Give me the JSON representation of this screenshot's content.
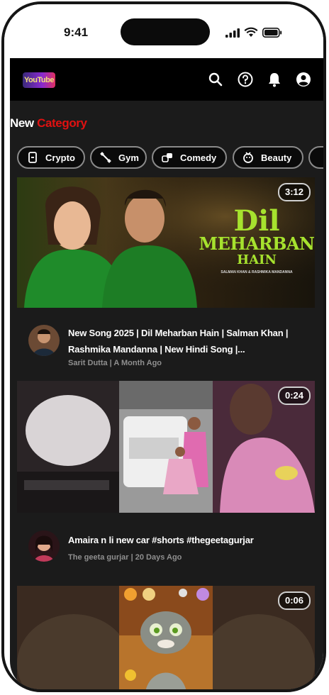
{
  "status_bar": {
    "time": "9:41"
  },
  "app_bar": {
    "logo_text": "YouTube",
    "icons": [
      "search-icon",
      "help-icon",
      "bell-icon",
      "account-icon"
    ]
  },
  "category_header": {
    "prefix": "New",
    "highlight": "Category",
    "highlight_color": "#e01111"
  },
  "chips": [
    {
      "label": "Crypto",
      "icon": "crypto-icon"
    },
    {
      "label": "Gym",
      "icon": "gym-icon"
    },
    {
      "label": "Comedy",
      "icon": "comedy-icon"
    },
    {
      "label": "Beauty",
      "icon": "beauty-icon"
    }
  ],
  "videos": [
    {
      "duration": "3:12",
      "thumbnail_text": {
        "line1": "Dil",
        "line2": "MEHARBAN",
        "line3": "HAIN",
        "line4": "SALMAN KHAN & RASHMIKA MANDANNA"
      },
      "title": "New Song 2025 | Dil Meharban Hain | Salman Khan | Rashmika Mandanna | New Hindi Song |...",
      "channel_info": "Sarit Dutta | A Month Ago"
    },
    {
      "duration": "0:24",
      "title": "Amaira n li new car #shorts #thegeetagurjar",
      "channel_info": "The geeta gurjar | 20 Days Ago"
    },
    {
      "duration": "0:06"
    }
  ],
  "colors": {
    "background": "#1b1b1b",
    "app_bar": "#000000",
    "accent": "#e01111",
    "thumbnail_green_text": "#a6e22e"
  }
}
